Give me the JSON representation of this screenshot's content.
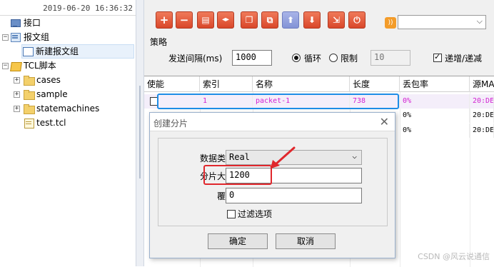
{
  "tree": {
    "timestamp": "2019-06-20 16:36:32",
    "items": [
      {
        "label": "接口",
        "icon": "interface-icon"
      },
      {
        "label": "报文组",
        "icon": "message-group-icon"
      },
      {
        "label": "新建报文组",
        "icon": "document-icon"
      },
      {
        "label": "TCL脚本",
        "icon": "script-icon"
      },
      {
        "label": "cases",
        "icon": "folder-icon"
      },
      {
        "label": "sample",
        "icon": "folder-icon"
      },
      {
        "label": "statemachines",
        "icon": "folder-icon"
      },
      {
        "label": "test.tcl",
        "icon": "file-icon"
      }
    ]
  },
  "toolbar": {
    "buttons": [
      {
        "glyph": "+",
        "name": "add"
      },
      {
        "glyph": "−",
        "name": "remove"
      },
      {
        "glyph": "▤",
        "name": "edit"
      },
      {
        "glyph": "◂▸",
        "name": "split"
      },
      {
        "glyph": "❐",
        "name": "copy"
      },
      {
        "glyph": "⧉",
        "name": "paste"
      },
      {
        "glyph": "⬆",
        "name": "move-up"
      },
      {
        "glyph": "⬇",
        "name": "move-down"
      },
      {
        "glyph": "⇲",
        "name": "import"
      },
      {
        "glyph": "⏻",
        "name": "power"
      }
    ],
    "dropdown_value": ""
  },
  "strategy": {
    "title": "策略",
    "interval_label": "发送间隔(ms)",
    "interval_value": "1000",
    "loop_label": "循环",
    "limit_label": "限制",
    "limit_value": "10",
    "incdec_label": "递增/递减",
    "loop_checked": true,
    "incdec_checked": true
  },
  "table": {
    "headers": [
      "使能",
      "索引",
      "名称",
      "长度",
      "丢包率",
      "源MAC"
    ],
    "rows": [
      {
        "index": "1",
        "name": "packet-1",
        "length": "738",
        "loss": "0%",
        "src": "20:DE"
      },
      {
        "index": "",
        "name": "",
        "length": "",
        "loss": "0%",
        "src": "20:DE"
      },
      {
        "index": "",
        "name": "",
        "length": "",
        "loss": "0%",
        "src": "20:DE"
      }
    ]
  },
  "dialog": {
    "title": "创建分片",
    "type_label": "数据类型",
    "type_value": "Real",
    "size_label": "分片大小",
    "size_value": "1200",
    "cover_label": "覆盖",
    "cover_value": "0",
    "filter_label": "过滤选项",
    "ok_label": "确定",
    "cancel_label": "取消"
  },
  "watermark": "CSDN @风云说通信",
  "colors": {
    "toolbar_red": "#d9472a",
    "highlight_blue": "#1e8de6",
    "annotation_red": "#e0272c",
    "packet_text_magenta": "#d21fd2"
  }
}
